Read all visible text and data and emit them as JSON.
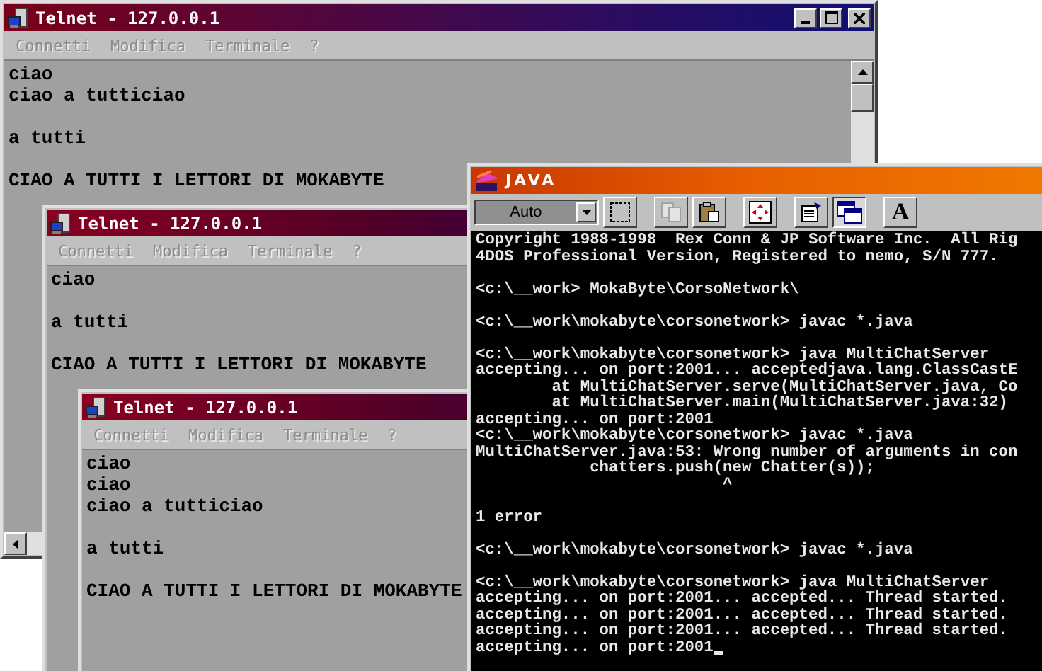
{
  "telnet_windows": [
    {
      "title": "Telnet - 127.0.0.1",
      "active": true,
      "title_buttons": true,
      "scrollbars": true,
      "menu": [
        {
          "label": "Connetti",
          "disabled": true
        },
        {
          "label": "Modifica",
          "disabled": true
        },
        {
          "label": "Terminale",
          "disabled": true
        },
        {
          "label": "?",
          "disabled": true
        }
      ],
      "paragraphs": [
        [
          "ciao",
          "ciao a tutticiao"
        ],
        [
          "a tutti"
        ],
        [
          "CIAO A TUTTI I LETTORI DI MOKABYTE"
        ]
      ]
    },
    {
      "title": "Telnet - 127.0.0.1",
      "active": false,
      "title_buttons": false,
      "scrollbars": false,
      "menu": [
        {
          "label": "Connetti",
          "disabled": true
        },
        {
          "label": "Modifica",
          "disabled": true
        },
        {
          "label": "Terminale",
          "disabled": true
        },
        {
          "label": "?",
          "disabled": true
        }
      ],
      "paragraphs": [
        [
          "ciao"
        ],
        [
          "a tutti"
        ],
        [
          "CIAO A TUTTI I LETTORI DI MOKABYTE"
        ]
      ]
    },
    {
      "title": "Telnet - 127.0.0.1",
      "active": false,
      "title_buttons": false,
      "scrollbars": false,
      "menu": [
        {
          "label": "Connetti",
          "disabled": true
        },
        {
          "label": "Modifica",
          "disabled": true
        },
        {
          "label": "Terminale",
          "disabled": true
        },
        {
          "label": "?",
          "disabled": true
        }
      ],
      "paragraphs": [
        [
          "ciao",
          "ciao",
          "ciao a tutticiao"
        ],
        [
          "a tutti"
        ],
        [
          "CIAO A TUTTI I LETTORI DI MOKABYTE"
        ]
      ]
    }
  ],
  "java_window": {
    "title": "JAVA",
    "font_select": {
      "value": "Auto"
    },
    "toolbar": [
      {
        "kind": "select",
        "selected": false,
        "disabled": false
      },
      {
        "kind": "copy",
        "selected": false,
        "disabled": true
      },
      {
        "kind": "paste",
        "selected": false,
        "disabled": false
      },
      {
        "kind": "fit",
        "selected": false,
        "disabled": false
      },
      {
        "kind": "properties",
        "selected": false,
        "disabled": false
      },
      {
        "kind": "window",
        "selected": true,
        "disabled": false
      },
      {
        "kind": "font",
        "label": "A",
        "selected": false,
        "disabled": false
      }
    ],
    "console": {
      "cursor": true,
      "paragraphs": [
        [
          "Copyright 1988-1998  Rex Conn & JP Software Inc.  All Rig",
          "4DOS Professional Version, Registered to nemo, S/N 777."
        ],
        [
          "<c:\\__work> MokaByte\\CorsoNetwork\\"
        ],
        [
          "<c:\\__work\\mokabyte\\corsonetwork> javac *.java"
        ],
        [
          "<c:\\__work\\mokabyte\\corsonetwork> java MultiChatServer",
          "accepting... on port:2001... acceptedjava.lang.ClassCastE",
          "        at MultiChatServer.serve(MultiChatServer.java, Co",
          "        at MultiChatServer.main(MultiChatServer.java:32)",
          "accepting... on port:2001",
          "<c:\\__work\\mokabyte\\corsonetwork> javac *.java",
          "MultiChatServer.java:53: Wrong number of arguments in con",
          "            chatters.push(new Chatter(s));",
          "                          ^"
        ],
        [
          "1 error"
        ],
        [
          "<c:\\__work\\mokabyte\\corsonetwork> javac *.java"
        ],
        [
          "<c:\\__work\\mokabyte\\corsonetwork> java MultiChatServer",
          "accepting... on port:2001... accepted... Thread started.",
          "accepting... on port:2001... accepted... Thread started.",
          "accepting... on port:2001... accepted... Thread started.",
          "accepting... on port:2001"
        ]
      ]
    }
  }
}
